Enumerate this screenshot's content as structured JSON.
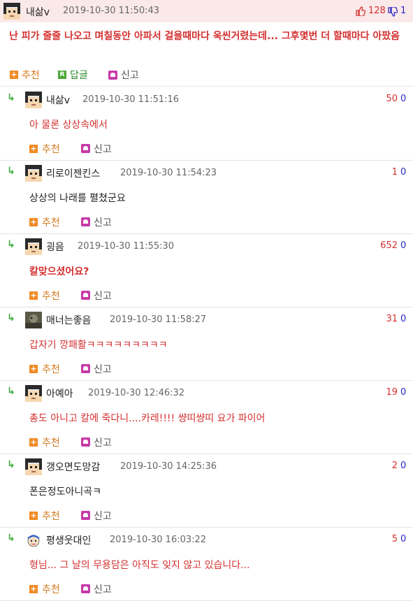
{
  "labels": {
    "recommend": "추천",
    "reply": "답글",
    "report": "신고",
    "reply_icon_glyph": "R",
    "plus_glyph": "+"
  },
  "main_comment": {
    "nickname": "내삶v",
    "date": "2019-10-30 11:50:43",
    "up": "128",
    "down": "1",
    "text": "난 피가 줄줄 나오고 며칠동안 아파서 걸을때마다 욱씬거렸는데... 그후몇번 더 할때마다 아팠음",
    "avatar": "pixel-face-icon"
  },
  "replies": [
    {
      "nickname": "내삶v",
      "date": "2019-10-30 11:51:16",
      "up": "50",
      "down": "0",
      "text": "아 물론 상상속에서",
      "style": "red",
      "avatar": "pixel-face-icon"
    },
    {
      "nickname": "리로이젠킨스",
      "date": "2019-10-30 11:54:23",
      "up": "1",
      "down": "0",
      "text": "상상의 나래를 펼쳤군요",
      "style": "dark",
      "avatar": "pixel-face-icon"
    },
    {
      "nickname": "굉음",
      "date": "2019-10-30 11:55:30",
      "up": "652",
      "down": "0",
      "text": "칼맞으셨어요?",
      "style": "bold",
      "avatar": "pixel-face-icon"
    },
    {
      "nickname": "매너는좋음",
      "date": "2019-10-30 11:58:27",
      "up": "31",
      "down": "0",
      "text": "갑자기 깡패활ㅋㅋㅋㅋㅋㅋㅋㅋㅋ",
      "style": "red",
      "avatar": "photo-avatar-icon"
    },
    {
      "nickname": "아예아",
      "date": "2019-10-30 12:46:32",
      "up": "19",
      "down": "0",
      "text": "총도 아니고 칼에 죽다니....카레!!!! 썅띠썅띠 요가 파이어",
      "style": "red",
      "avatar": "pixel-face-icon"
    },
    {
      "nickname": "갱오면도망감",
      "date": "2019-10-30 14:25:36",
      "up": "2",
      "down": "0",
      "text": "폰은정도아니곡ㅋ",
      "style": "dark",
      "avatar": "pixel-face-icon"
    },
    {
      "nickname": "평생웃대인",
      "date": "2019-10-30 16:03:22",
      "up": "5",
      "down": "0",
      "text": "형님... 그 날의 무용담은 아직도 잊지 않고 있습니다...",
      "style": "red",
      "avatar": "cartoon-avatar-icon"
    }
  ],
  "colors": {
    "vote_up": "#d43030",
    "vote_down": "#2828c8",
    "header_bg": "#fbe9ea",
    "body_red": "#d43030"
  }
}
